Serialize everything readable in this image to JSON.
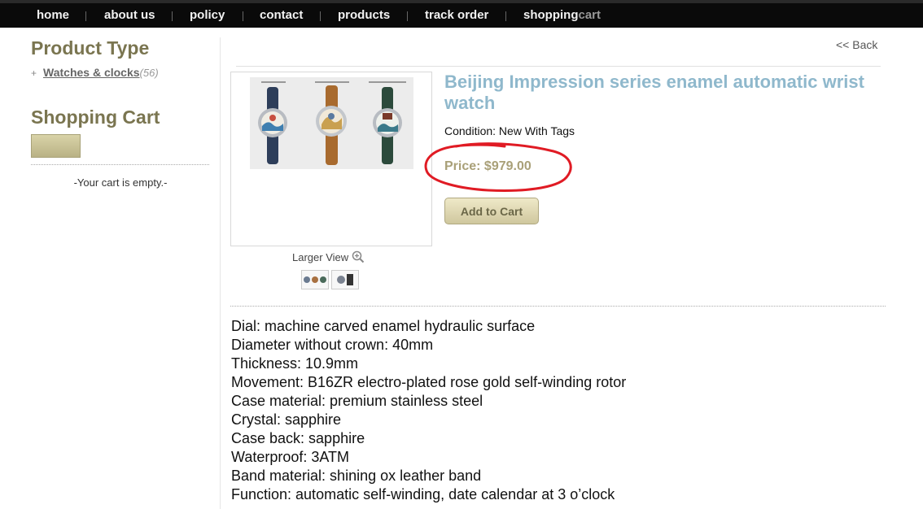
{
  "nav": {
    "home": "home",
    "about": "about us",
    "policy": "policy",
    "contact": "contact",
    "products": "products",
    "track": "track order",
    "cart_main": "shopping",
    "cart_suffix": "cart"
  },
  "sidebar": {
    "product_type_heading": "Product Type",
    "category": {
      "label": "Watches & clocks",
      "count": "(56)"
    },
    "cart_heading": "Shopping Cart",
    "cart_empty": "-Your cart is empty.-"
  },
  "main": {
    "back": "<< Back",
    "title": "Beijing Impression series enamel automatic wrist watch",
    "condition": "Condition: New With Tags",
    "price": "Price: $979.00",
    "add_to_cart": "Add to Cart",
    "larger_view": "Larger View"
  },
  "description": [
    "Dial: machine carved enamel hydraulic surface",
    "Diameter without crown: 40mm",
    "Thickness: 10.9mm",
    "Movement: B16ZR electro-plated rose gold self-winding rotor",
    "Case material: premium stainless steel",
    "Crystal: sapphire",
    "Case back: sapphire",
    "Waterproof: 3ATM",
    "Band material: shining ox leather band",
    "Function: automatic self-winding, date calendar at 3 o’clock"
  ],
  "colors": {
    "nav_bg": "#0a0a0a",
    "heading": "#7a7550",
    "title": "#8fb8cc",
    "price": "#a9a078",
    "annotation": "#e01b24"
  }
}
